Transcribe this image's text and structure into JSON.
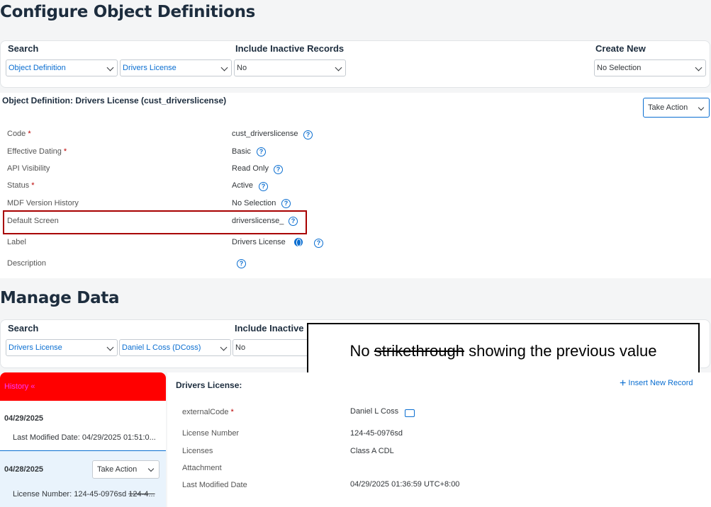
{
  "config": {
    "title": "Configure Object Definitions",
    "search_label": "Search",
    "search_type": "Object Definition",
    "search_value": "Drivers License",
    "include_label": "Include Inactive Records",
    "include_value": "No",
    "create_label": "Create New",
    "create_value": "No Selection"
  },
  "detail": {
    "heading": "Object Definition: Drivers License (cust_driverslicense)",
    "take_action": "Take Action",
    "fields": [
      {
        "label": "Code",
        "value": "cust_driverslicense"
      },
      {
        "label": "Effective Dating",
        "value": "Basic"
      },
      {
        "label": "API Visibility",
        "value": "Read Only"
      },
      {
        "label": "Status",
        "value": "Active"
      },
      {
        "label": "MDF Version History",
        "value": "No Selection"
      },
      {
        "label": "Default Screen",
        "value": "driverslicense_"
      },
      {
        "label": "Label",
        "value": "Drivers License"
      },
      {
        "label": "Description",
        "value": ""
      }
    ],
    "required_mark": "*",
    "help_glyph": "?",
    "highlight_color": "#a80000"
  },
  "manage": {
    "title": "Manage Data",
    "search_label": "Search",
    "search_type": "Drivers License",
    "search_value": "Daniel L Coss (DCoss)",
    "include_label": "Include Inactive R",
    "include_value": "No"
  },
  "callout": {
    "before": "No ",
    "struck": "strikethrough",
    "after": " showing the previous value"
  },
  "history": {
    "header": "History",
    "header_arrow": "«",
    "header_color": "#ff0000",
    "entries": [
      {
        "date": "04/29/2025",
        "detail": "Last Modified Date: 04/29/2025 01:51:0..."
      },
      {
        "date": "04/28/2025",
        "detail_prefix": "License Number: 124-45-0976sd ",
        "detail_struck": "124-4...",
        "action": "Take Action"
      }
    ]
  },
  "record": {
    "heading": "Drivers License:",
    "insert_label": "Insert New Record",
    "fields": [
      {
        "label": "externalCode",
        "value": "Daniel L Coss"
      },
      {
        "label": "License Number",
        "value": "124-45-0976sd"
      },
      {
        "label": "Licenses",
        "value": "Class A CDL"
      },
      {
        "label": "Attachment",
        "value": ""
      },
      {
        "label": "Last Modified Date",
        "value": "04/29/2025 01:36:59 UTC+8:00"
      }
    ]
  },
  "colors": {
    "accent": "#0a6ed1",
    "heading": "#1d2d3e"
  }
}
